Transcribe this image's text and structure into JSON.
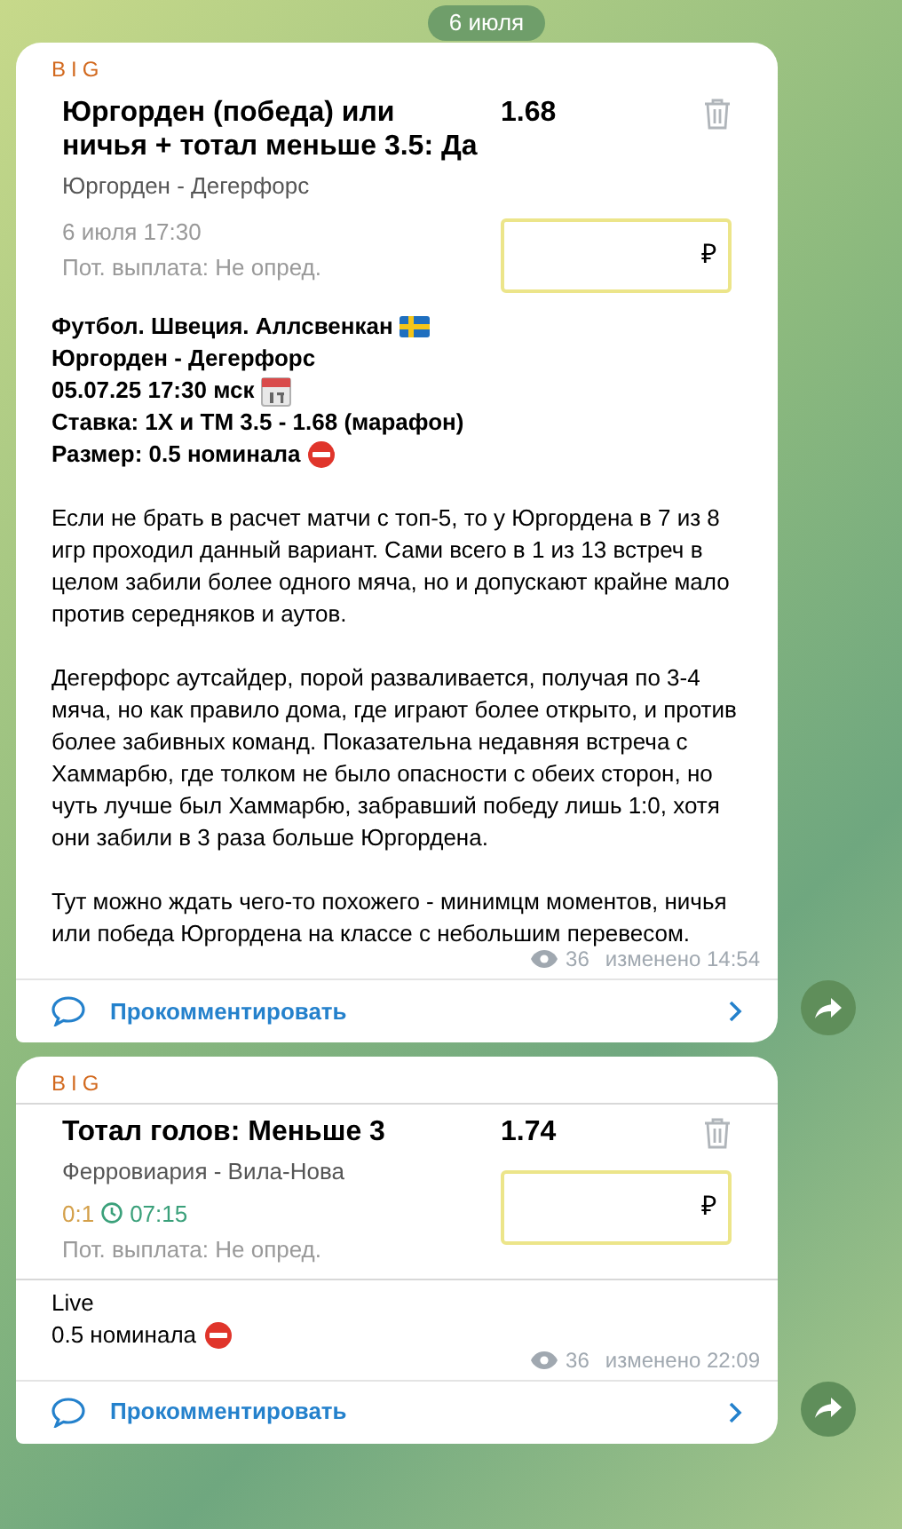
{
  "date_chip": "6 июля",
  "posts": [
    {
      "channel": "BIG",
      "bet": {
        "kind": "prematch",
        "title": "Юргорден (победа) или ничья + тотал меньше 3.5: Да",
        "odds": "1.68",
        "match": "Юргорден - Дегерфорс",
        "time": "6 июля 17:30",
        "payout": "Пот. выплата: Не опред.",
        "currency": "₽"
      },
      "body": [
        {
          "lines": [
            {
              "text": "Футбол. Швеция. Аллсвенкан",
              "bold": true,
              "kind": "flag"
            },
            {
              "text": "Юргорден - Дегерфорс",
              "bold": true
            },
            {
              "text": "05.07.25 17:30 мск",
              "bold": true,
              "kind": "calendar"
            },
            {
              "text": "Ставка: 1Х и ТМ 3.5 - 1.68 (марафон)",
              "bold": true
            },
            {
              "text": "Размер: 0.5 номинала",
              "bold": true,
              "kind": "no_entry"
            }
          ]
        },
        {
          "lines": [
            {
              "text": "Если не брать в расчет матчи с топ-5, то у Юргордена в 7 из 8 игр проходил данный вариант. Сами всего в 1 из 13 встреч в целом забили более одного мяча, но и допускают крайне мало против середняков и аутов.",
              "bold": false
            }
          ]
        },
        {
          "lines": [
            {
              "text": "Дегерфорс аутсайдер, порой разваливается, получая по 3-4 мяча, но как правило дома, где играют более открыто, и против более забивных команд. Показательна недавняя встреча с Хаммарбю, где толком не было опасности с обеих сторон, но чуть лучше был Хаммарбю, забравший победу лишь 1:0, хотя они забили в 3 раза больше Юргордена.",
              "bold": false
            }
          ]
        },
        {
          "lines": [
            {
              "text": "Тут можно ждать чего-то похожего - минимцм моментов, ничья или победа Юргордена на классе с небольшим перевесом.",
              "bold": false
            }
          ]
        }
      ],
      "views": "36",
      "edited": "изменено 14:54",
      "comment": "Прокомментировать"
    },
    {
      "channel": "BIG",
      "bet": {
        "kind": "live",
        "title": "Тотал голов: Меньше 3",
        "odds": "1.74",
        "match": "Ферровиария - Вила-Нова",
        "score": "0:1",
        "clock": "07:15",
        "payout": "Пот. выплата: Не опред.",
        "currency": "₽"
      },
      "body": [
        {
          "lines": [
            {
              "text": "Live",
              "bold": false
            },
            {
              "text": "0.5 номинала",
              "bold": false,
              "kind": "no_entry"
            }
          ]
        }
      ],
      "views": "36",
      "edited": "изменено 22:09",
      "comment": "Прокомментировать"
    }
  ]
}
